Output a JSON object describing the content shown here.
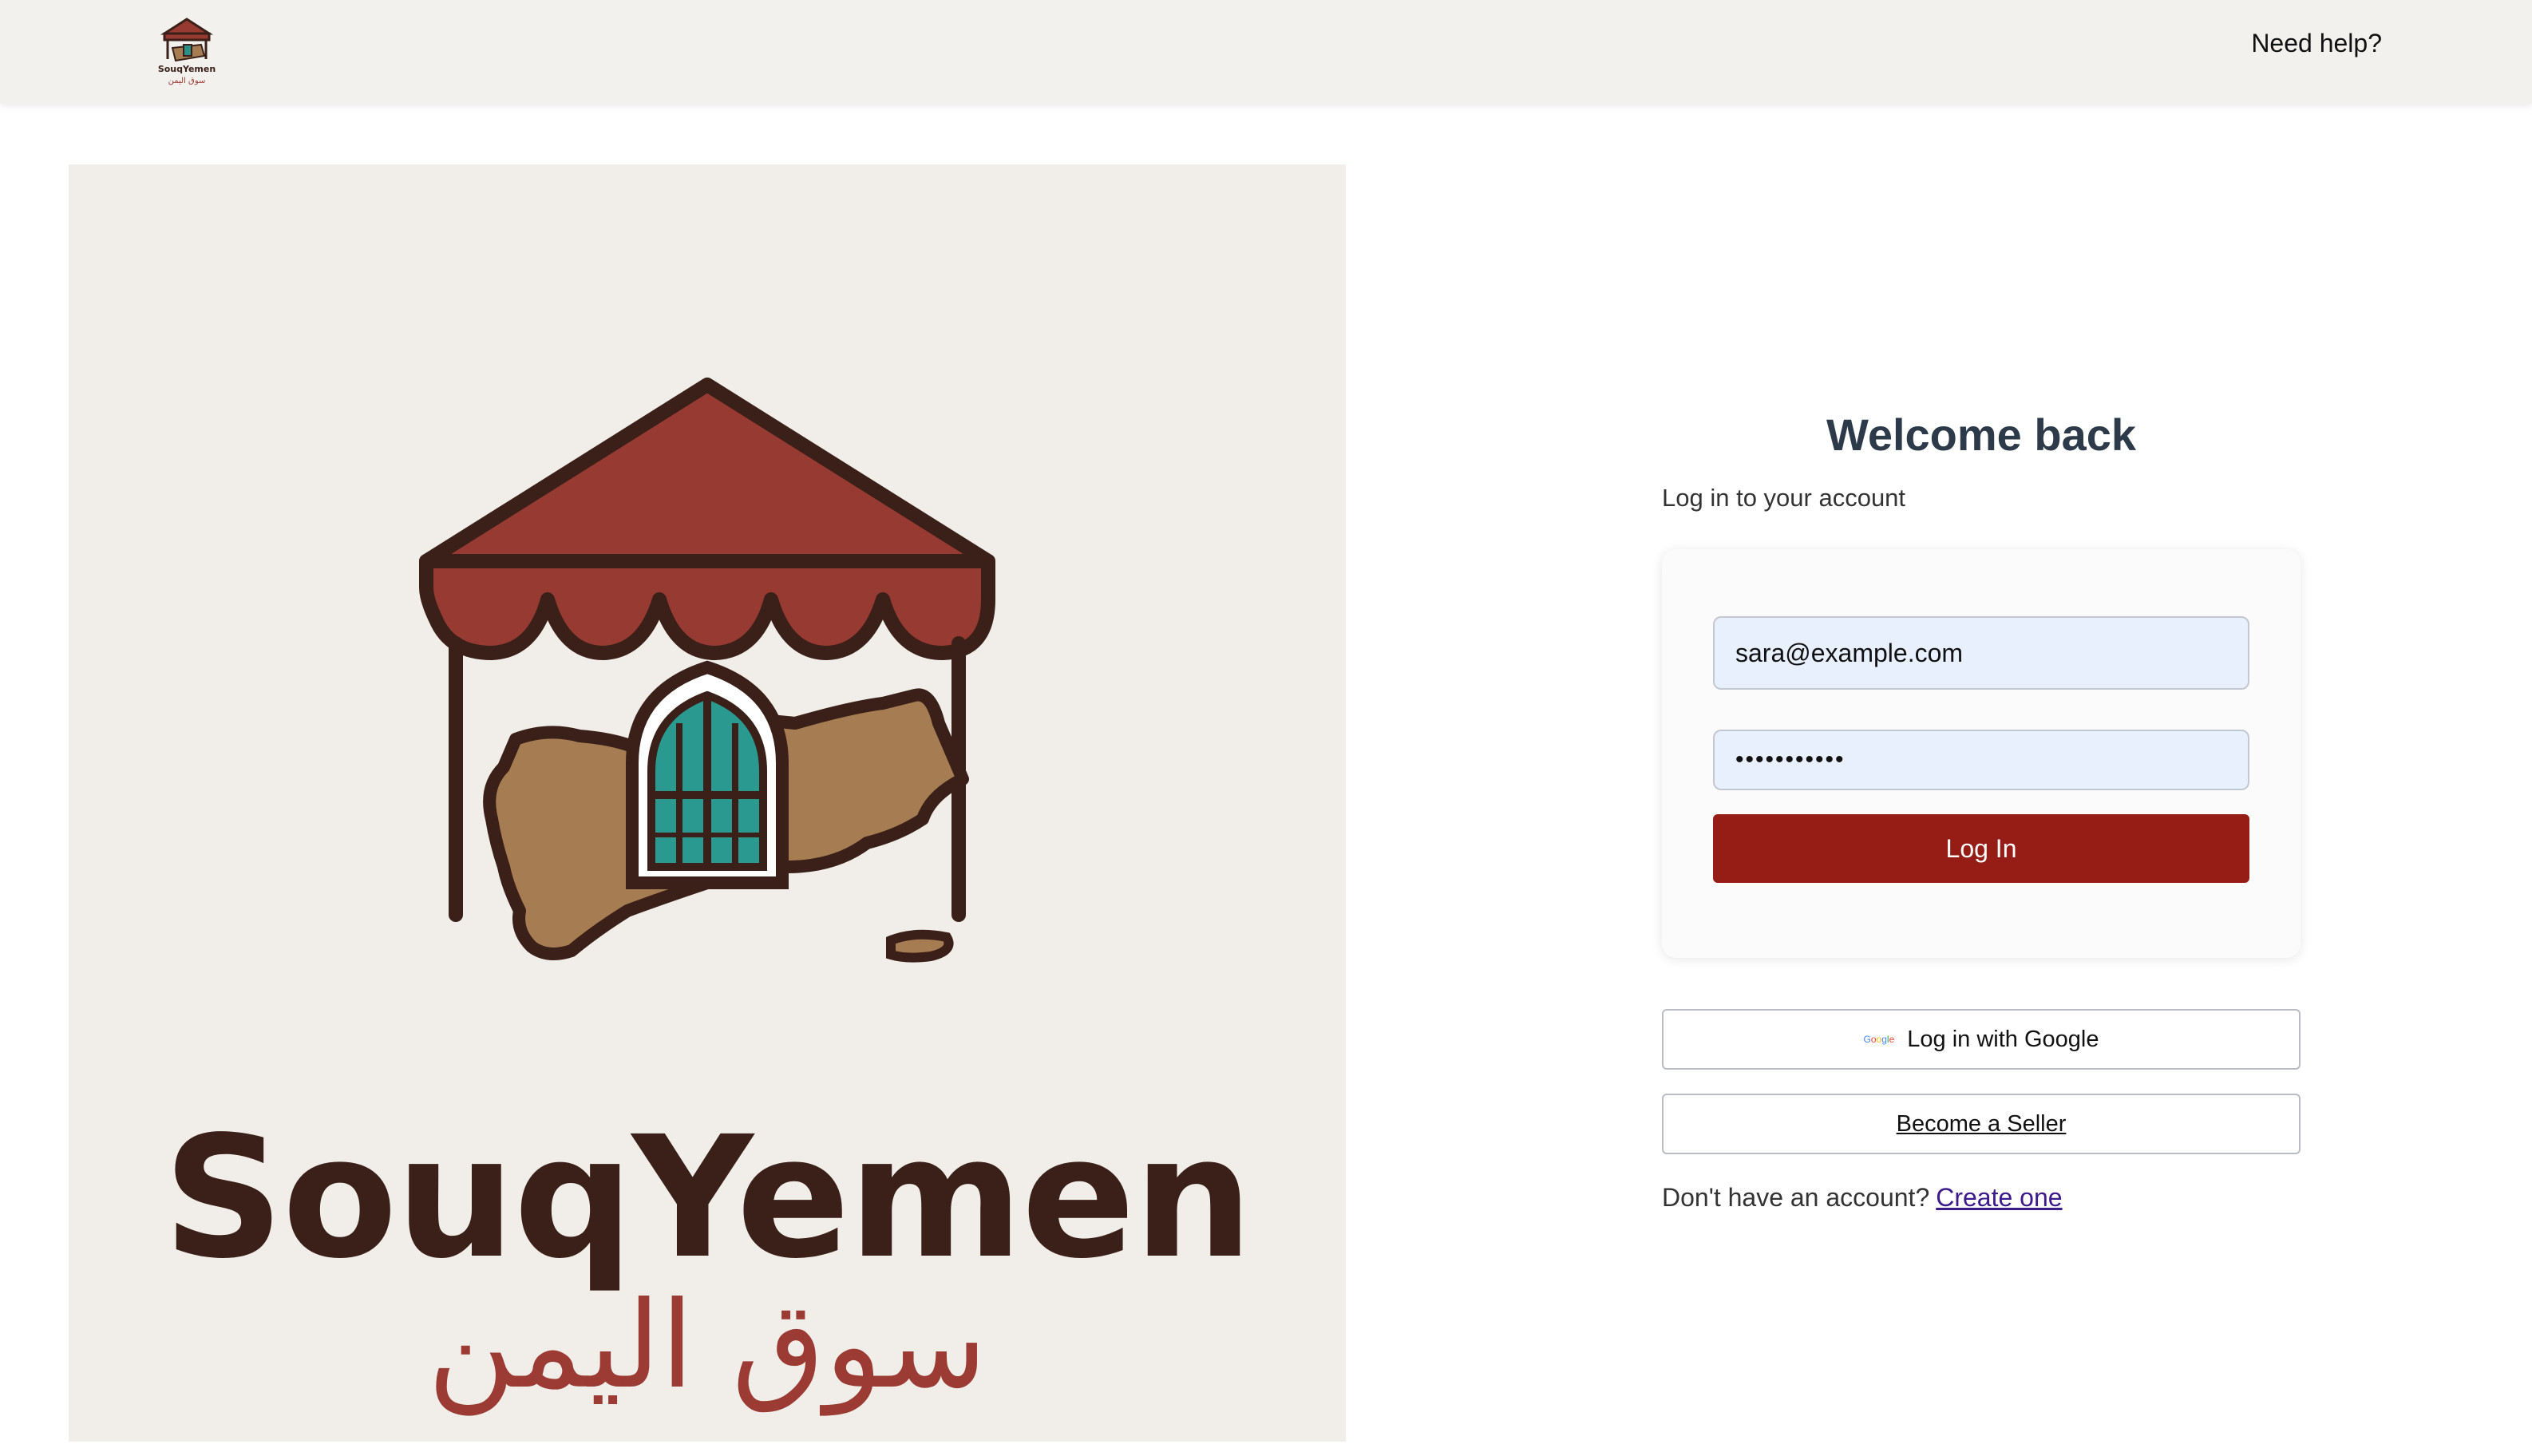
{
  "header": {
    "logo_name": "SouqYemen",
    "logo_arabic": "سوق اليمن",
    "help_label": "Need help?"
  },
  "hero": {
    "wordmark": "SouqYemen",
    "arabic": "سوق اليمن"
  },
  "login": {
    "title": "Welcome back",
    "subtitle": "Log in to your account",
    "email_value": "sara@example.com",
    "password_value": "•••••••••••",
    "submit_label": "Log In",
    "google_label": "Log in with Google",
    "google_mark": "Google",
    "seller_label": "Become a Seller",
    "signup_prompt": "Don't have an account?",
    "signup_link": "Create one"
  },
  "colors": {
    "brand_red": "#961d16",
    "header_bg": "#f3f1ed",
    "input_bg": "#e8f0fe",
    "title_color": "#2d3a4a"
  }
}
